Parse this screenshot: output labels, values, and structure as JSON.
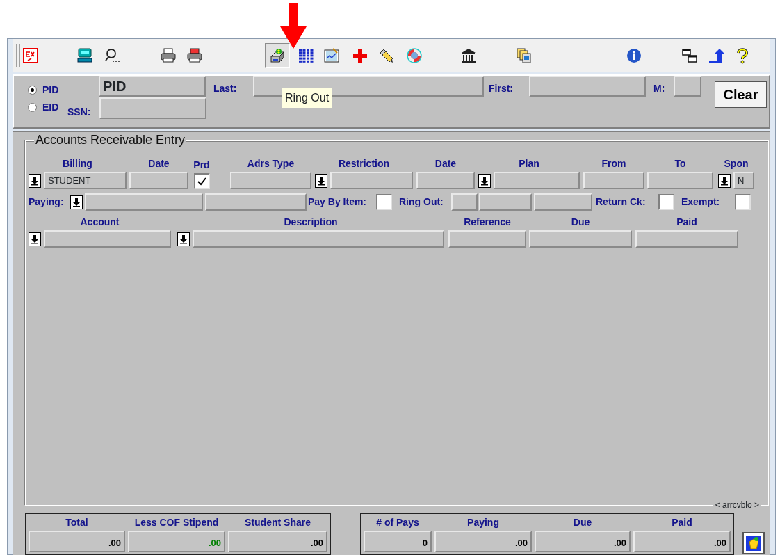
{
  "toolbar": [
    {
      "kind": "exit",
      "pressed": false
    },
    {
      "kind": "keyboard",
      "pressed": false
    },
    {
      "kind": "search",
      "pressed": false
    },
    {
      "kind": "printer",
      "pressed": false
    },
    {
      "kind": "printer-red",
      "pressed": false
    },
    {
      "kind": "register",
      "pressed": true
    },
    {
      "kind": "grid",
      "pressed": false
    },
    {
      "kind": "chart",
      "pressed": false
    },
    {
      "kind": "cross",
      "pressed": false
    },
    {
      "kind": "eraser",
      "pressed": false
    },
    {
      "kind": "lifebuoy",
      "pressed": false
    },
    {
      "kind": "bank",
      "pressed": false
    },
    {
      "kind": "documents",
      "pressed": false
    },
    {
      "kind": "info",
      "pressed": false
    },
    {
      "kind": "windows",
      "pressed": false
    },
    {
      "kind": "up-arrow",
      "pressed": false
    },
    {
      "kind": "help",
      "pressed": false
    }
  ],
  "tooltip": "Ring Out",
  "id_type": [
    {
      "label": "PID",
      "selected": true
    },
    {
      "label": "EID",
      "selected": false
    }
  ],
  "id_value": "PID",
  "ssn_label": "SSN:",
  "last_label": "Last:",
  "first_label": "First:",
  "m_label": "M:",
  "clear_button": "Clear",
  "section_title": "Accounts Receivable Entry",
  "billing_row": [
    {
      "header": "Billing",
      "kind": "field",
      "dropdown": true,
      "value": "STUDENT"
    },
    {
      "header": "Date",
      "kind": "field",
      "dropdown": false
    },
    {
      "header": "Prd",
      "kind": "checkbox",
      "dropdown": false,
      "checked": true
    },
    {
      "header": "Adrs Type",
      "kind": "field",
      "dropdown": false
    },
    {
      "header": "Restriction",
      "kind": "field",
      "dropdown": true
    },
    {
      "header": "Date",
      "kind": "field",
      "dropdown": false
    },
    {
      "header": "Plan",
      "kind": "field",
      "dropdown": true
    },
    {
      "header": "From",
      "kind": "field",
      "dropdown": false
    },
    {
      "header": "To",
      "kind": "field",
      "dropdown": false
    },
    {
      "header": "Spon",
      "kind": "field",
      "dropdown": true,
      "value": "N"
    }
  ],
  "paying_row": [
    {
      "kind": "label",
      "text": "Paying:"
    },
    {
      "kind": "dropdown"
    },
    {
      "kind": "field"
    },
    {
      "kind": "field"
    },
    {
      "kind": "label",
      "text": "Pay By Item:"
    },
    {
      "kind": "checkbox",
      "checked": false
    },
    {
      "kind": "label",
      "text": "Ring Out:"
    },
    {
      "kind": "field"
    },
    {
      "kind": "field"
    },
    {
      "kind": "field"
    },
    {
      "kind": "label",
      "text": "Return Ck:"
    },
    {
      "kind": "checkbox",
      "checked": false
    },
    {
      "kind": "label",
      "text": "Exempt:"
    },
    {
      "kind": "checkbox",
      "checked": false
    }
  ],
  "account_row": [
    {
      "header": "Account",
      "kind": "field",
      "dropdown": true
    },
    {
      "header": "Description",
      "kind": "field",
      "dropdown": true
    },
    {
      "header": "Reference",
      "kind": "field",
      "dropdown": false
    },
    {
      "header": "Due",
      "kind": "field",
      "dropdown": false
    },
    {
      "header": "Paid",
      "kind": "field",
      "dropdown": false
    }
  ],
  "block_name": "< arrcvblo >",
  "totals": [
    {
      "header": "Total",
      "value": ".00",
      "color": "#000000"
    },
    {
      "header": "Less COF Stipend",
      "value": ".00",
      "color": "#008000"
    },
    {
      "header": "Student Share",
      "value": ".00",
      "color": "#000000"
    }
  ],
  "payments": [
    {
      "header": "# of Pays",
      "value": "0",
      "color": "#000000"
    },
    {
      "header": "Paying",
      "value": ".00",
      "color": "#000000"
    },
    {
      "header": "Due",
      "value": ".00",
      "color": "#000000"
    },
    {
      "header": "Paid",
      "value": ".00",
      "color": "#000000"
    }
  ]
}
